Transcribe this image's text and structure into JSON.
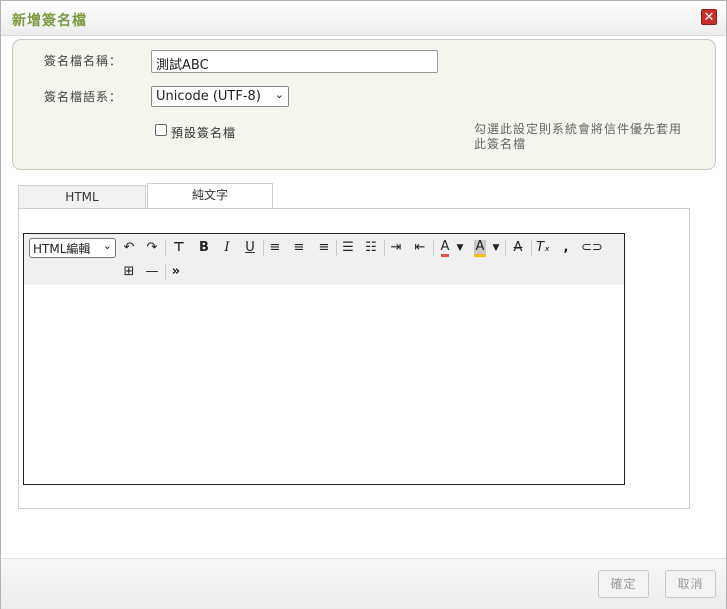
{
  "dialog": {
    "title": "新增簽名檔",
    "close_icon": "close-icon",
    "close_color": "#c9302c"
  },
  "form": {
    "name_label": "簽名檔名稱：",
    "name_value": "測試ABC",
    "lang_label": "簽名檔語系：",
    "lang_value": "Unicode (UTF-8)",
    "default_label": "預設簽名檔",
    "default_checked": false,
    "note": "勾選此設定則系統會將信件優先套用此簽名檔"
  },
  "tabs": [
    {
      "label": "HTML",
      "active": true
    },
    {
      "label": "純文字",
      "active": false
    }
  ],
  "editor": {
    "format_value": "HTML編輯",
    "content": ""
  },
  "footer": {
    "ok_label": "確定",
    "cancel_label": "取消"
  },
  "colors": {
    "title": "#7a9a40",
    "font_color_bar": "#d9534f",
    "bg_color_bar": "#f2c200"
  }
}
